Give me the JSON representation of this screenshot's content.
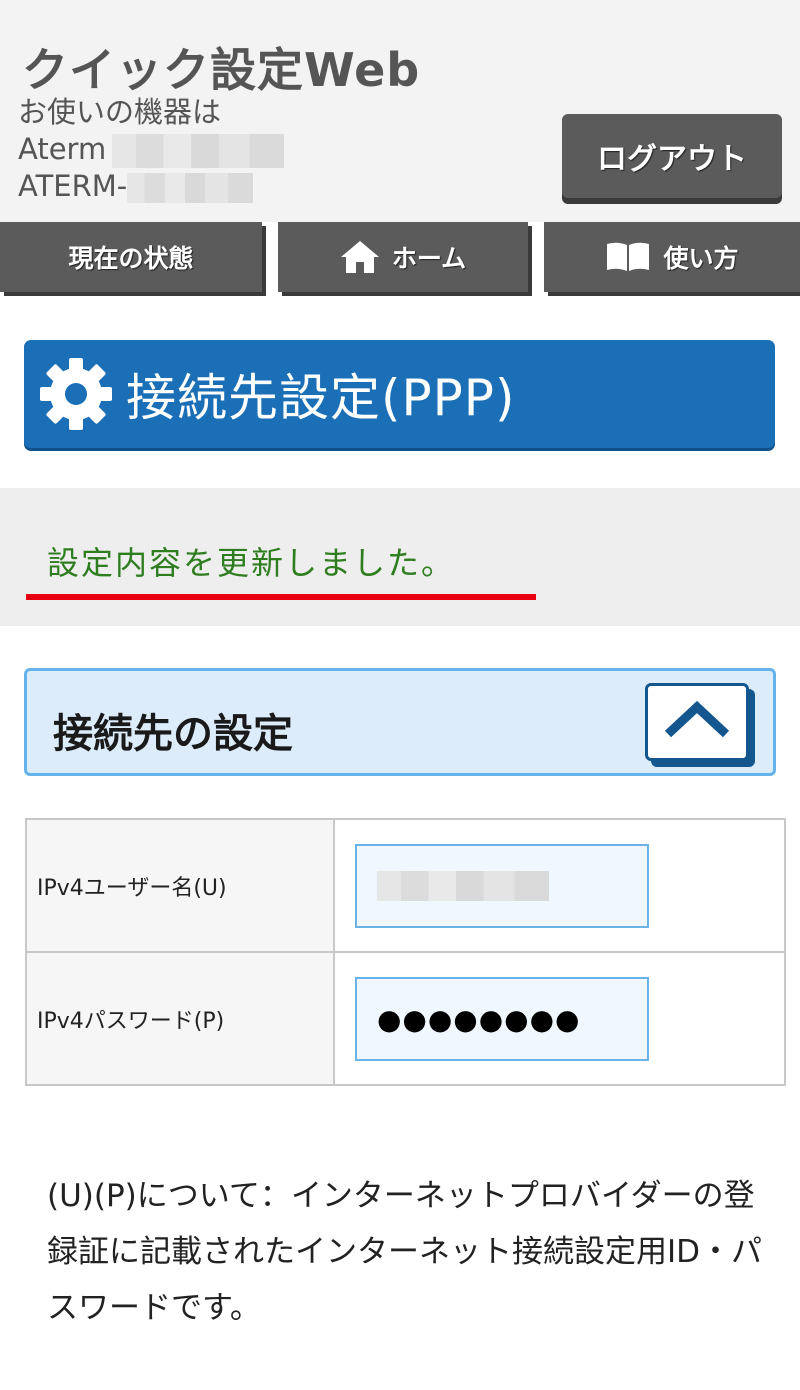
{
  "header": {
    "app_title": "クイック設定Web",
    "device_prefix": "お使いの機器は",
    "model_prefix": "Aterm",
    "ssid_prefix": "ATERM-",
    "logout_label": "ログアウト"
  },
  "nav": {
    "status_label": "現在の状態",
    "home_label": "ホーム",
    "help_label": "使い方"
  },
  "page": {
    "title": "接続先設定(PPP)"
  },
  "status": {
    "message": "設定内容を更新しました。"
  },
  "section": {
    "title": "接続先の設定"
  },
  "form": {
    "username_label": "IPv4ユーザー名(U)",
    "password_label": "IPv4パスワード(P)",
    "password_value": "●●●●●●●●"
  },
  "footnote": {
    "text": "(U)(P)について：インターネットプロバイダーの登録証に記載されたインターネット接続設定用ID・パスワードです。"
  },
  "colors": {
    "title_bar": "#1a6fb6",
    "status_text": "#2e7d1f",
    "status_underline": "#e60012",
    "nav_button": "#5b5b5b",
    "section_border": "#66b3ec"
  },
  "icons": {
    "nav_home": "home-icon",
    "nav_help": "book-icon",
    "title": "gear-icon",
    "section_toggle": "chevron-up-icon"
  }
}
